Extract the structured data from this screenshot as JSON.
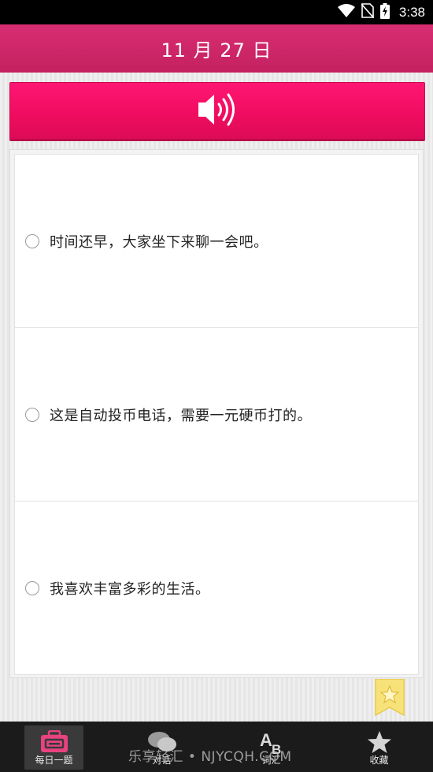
{
  "status_bar": {
    "time": "3:38",
    "icons": [
      "wifi-icon",
      "no-sim-icon",
      "battery-charging-icon"
    ]
  },
  "header": {
    "date": "11 月 27 日"
  },
  "audio": {
    "icon": "speaker-icon",
    "accent": "#f0105f"
  },
  "options": [
    {
      "text": "时间还早，大家坐下来聊一会吧。"
    },
    {
      "text": "这是自动投币电话，需要一元硬币打的。"
    },
    {
      "text": "我喜欢丰富多彩的生活。"
    }
  ],
  "bookmark": {
    "icon": "star-bookmark-icon"
  },
  "tabs": [
    {
      "label": "每日一题",
      "icon": "daily-question-icon",
      "active": true
    },
    {
      "label": "对话",
      "icon": "chat-icon",
      "active": false
    },
    {
      "label": "词汇",
      "icon": "vocabulary-icon",
      "active": false
    },
    {
      "label": "收藏",
      "icon": "star-icon",
      "active": false
    }
  ],
  "watermark": "乐享轻汇 • NJYCQH.COM",
  "colors": {
    "header": "#d02868",
    "tabbar": "#1b1b1b",
    "tab_icon_accent": "#e8427f"
  }
}
